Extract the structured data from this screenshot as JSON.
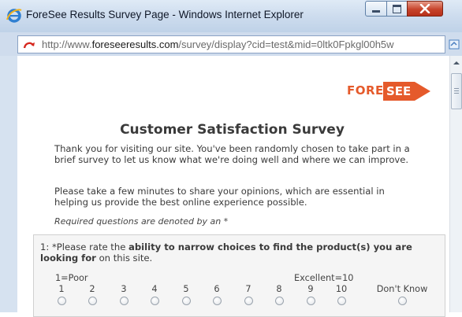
{
  "window": {
    "title": "ForeSee Results Survey Page - Windows Internet Explorer"
  },
  "address": {
    "url_prefix": "http://www.",
    "url_domain": "foreseeresults.com",
    "url_path": "/survey/display?cid=test&mid=0ltk0Fpkgl00h5w"
  },
  "logo": {
    "text_fore": "FORE",
    "text_see": "SEE",
    "accent": "#e55a2b"
  },
  "survey": {
    "title": "Customer Satisfaction Survey",
    "intro": "Thank you for visiting our site. You've been randomly chosen to take part in a brief survey to let us know what we're doing well and where we can improve.",
    "intro2": "Please take a few minutes to share your opinions, which are essential in helping us provide the best online experience possible.",
    "required_note": "Required questions are denoted by an *"
  },
  "question": {
    "prefix": "1: *Please rate the ",
    "bold": "ability to narrow choices to find the product(s) you are looking for",
    "suffix": " on this site.",
    "scale_low": "1=Poor",
    "scale_high": "Excellent=10",
    "options": [
      "1",
      "2",
      "3",
      "4",
      "5",
      "6",
      "7",
      "8",
      "9",
      "10",
      "Don't Know"
    ]
  }
}
